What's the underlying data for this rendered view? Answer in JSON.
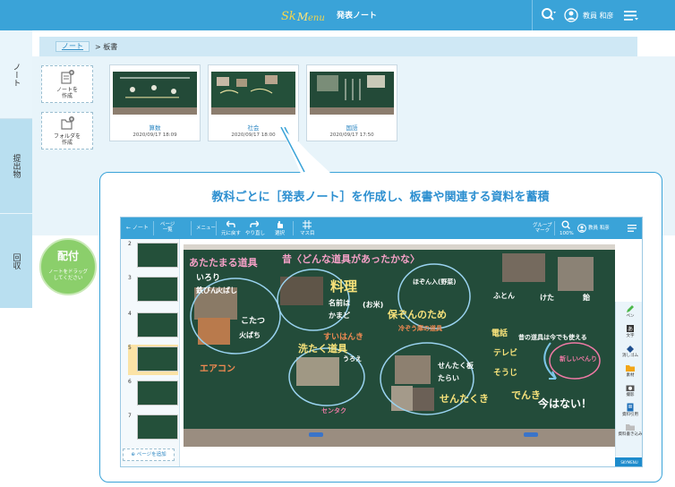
{
  "header": {
    "logo_text": "SKYMENU",
    "app_title": "発表ノート",
    "user_name": "教員 和彦"
  },
  "sidebar": {
    "tabs": [
      {
        "label": "ノート"
      },
      {
        "label": "提出物"
      },
      {
        "label": "回収"
      }
    ]
  },
  "breadcrumb": {
    "root": "ノート",
    "separator": ">",
    "current": "板書"
  },
  "actions": {
    "create_note": "ノートを\n作成",
    "create_folder": "フォルダを\n作成"
  },
  "notes": [
    {
      "title": "算数",
      "date": "2020/09/17 18:09"
    },
    {
      "title": "社会",
      "date": "2020/09/17 18:00"
    },
    {
      "title": "国語",
      "date": "2020/09/17 17:50"
    }
  ],
  "distribute": {
    "label": "配付",
    "hint": "ノートをドラッグ\nしてください"
  },
  "callout": {
    "headline": "教科ごとに［発表ノート］を作成し、板書や関連する資料を蓄積"
  },
  "inner_toolbar": {
    "back": "← ノート",
    "page_list": "ページ\n一覧",
    "menu": "メニュー",
    "undo": "元に戻す",
    "redo": "やり直し",
    "select": "選択",
    "grid": "マス目",
    "group_mark": "グループ\nマーク",
    "zoom": "100%",
    "user": "教員 和彦"
  },
  "pages": [
    {
      "num": "2"
    },
    {
      "num": "3"
    },
    {
      "num": "4"
    },
    {
      "num": "5"
    },
    {
      "num": "6"
    },
    {
      "num": "7"
    }
  ],
  "add_page": "⊕ ページを追加",
  "tools": [
    {
      "label": "ペン"
    },
    {
      "label": "文字"
    },
    {
      "label": "消しゴム"
    },
    {
      "label": "素材"
    },
    {
      "label": "撮影"
    },
    {
      "label": "資料引用"
    },
    {
      "label": "資料書き込み"
    }
  ],
  "brand": "SKYMENU",
  "board": {
    "heading": "昔〈どんな道具があったかな〉",
    "left_title": "あたたまる道具",
    "left_items": [
      "いろり",
      "鉄びん",
      "火ばし",
      "こたつ",
      "火ばち"
    ],
    "left_bottom": "エアコン",
    "center_title": "料理",
    "center_items": [
      "名前は",
      "かまど",
      "(お米)",
      "すいはんき"
    ],
    "center_bottom_title": "洗たく道具",
    "center_bottom_items": [
      "うろえ",
      "せんたく板",
      "たらい",
      "せんたくき",
      "センタク"
    ],
    "right_title": "ほぞん入(野菜)",
    "right_items": [
      "保ぞんのため",
      "冷ぞう庫の道具"
    ],
    "far_right": [
      "ふとん",
      "けた",
      "飴",
      "電話",
      "テレビ",
      "そうじ",
      "でんき"
    ],
    "far_right_note": "昔の道具は今でも使える",
    "conclusion": "今はない！",
    "note_red": "新しいべんり"
  }
}
